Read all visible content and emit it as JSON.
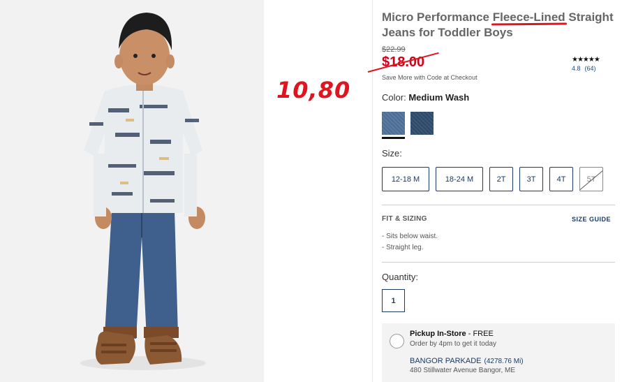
{
  "product": {
    "title_part1": "Micro Performance ",
    "title_highlight": "Fleece-Lined",
    "title_part2": " Straight Jeans for Toddler Boys",
    "original_price": "$22.99",
    "sale_price": "$18.00",
    "save_more": "Save More with Code at Checkout",
    "annotation_price": "10,80"
  },
  "rating": {
    "stars": "★★★★★",
    "score": "4.8",
    "count": "(64)"
  },
  "color": {
    "label": "Color:",
    "selected": "Medium Wash",
    "swatches": [
      "medium-wash",
      "dark-wash"
    ]
  },
  "size": {
    "label": "Size:",
    "options": [
      "12-18 M",
      "18-24 M",
      "2T",
      "3T",
      "4T",
      "5T"
    ],
    "unavailable": [
      "5T"
    ]
  },
  "fit": {
    "heading": "FIT & SIZING",
    "size_guide": "SIZE GUIDE",
    "items": [
      "Sits below waist.",
      "Straight leg."
    ]
  },
  "quantity": {
    "label": "Quantity:",
    "value": "1"
  },
  "pickup": {
    "title": "Pickup In-Store",
    "free": " - FREE",
    "order_by": "Order by 4pm to get it today",
    "store": "BANGOR PARKADE",
    "distance": "(4278.76 Mi)",
    "address": "480 Stillwater Avenue Bangor, ME"
  },
  "colors": {
    "accent": "#1a3a6a",
    "sale": "#d0021b",
    "annotation": "#e0141e"
  }
}
